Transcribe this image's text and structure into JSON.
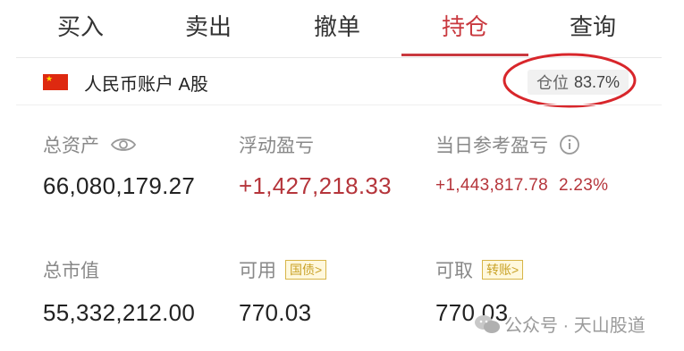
{
  "tabs": [
    {
      "label": "买入"
    },
    {
      "label": "卖出"
    },
    {
      "label": "撤单"
    },
    {
      "label": "持仓"
    },
    {
      "label": "查询"
    }
  ],
  "active_tab": "持仓",
  "account": {
    "label": "人民币账户 A股",
    "flag_icon": "china-flag-icon"
  },
  "position": {
    "label": "仓位",
    "value": "83.7%"
  },
  "stats": {
    "total_assets": {
      "label": "总资产",
      "value": "66,080,179.27"
    },
    "floating_pnl": {
      "label": "浮动盈亏",
      "value": "+1,427,218.33"
    },
    "daily_pnl": {
      "label": "当日参考盈亏",
      "value": "+1,443,817.78",
      "ratio": "2.23%"
    },
    "market_value": {
      "label": "总市值",
      "value": "55,332,212.00"
    },
    "available": {
      "label": "可用",
      "value": "770.03",
      "tag": "国债>"
    },
    "withdrawable": {
      "label": "可取",
      "value": "770.03",
      "tag": "转账>"
    }
  },
  "watermark": {
    "text": "公众号 · 天山股道"
  },
  "colors": {
    "accent_red": "#c9393f",
    "value_red": "#b5353b",
    "tag_gold": "#c9a227",
    "annotation_circle": "#d8262b"
  }
}
